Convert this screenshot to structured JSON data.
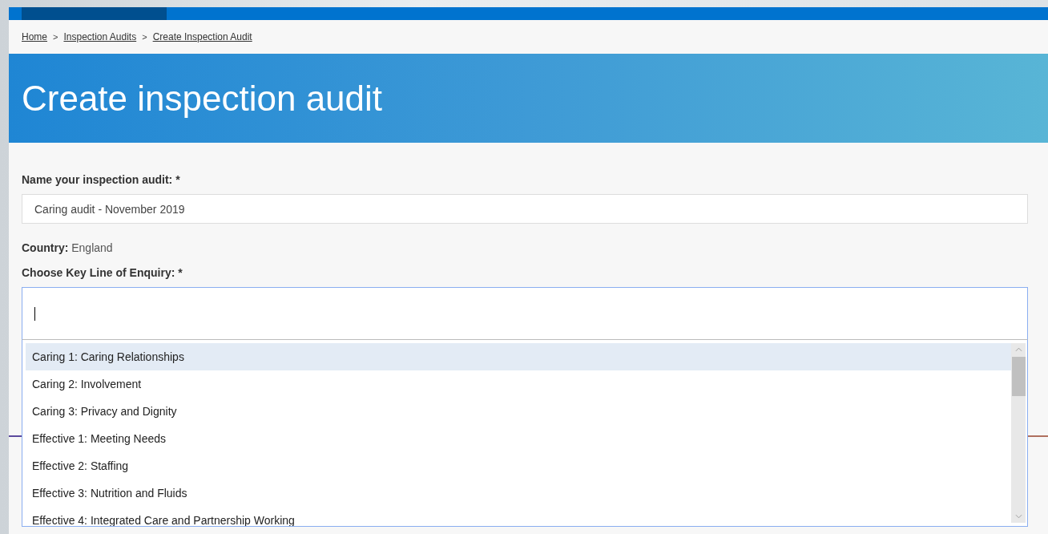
{
  "breadcrumb": [
    {
      "label": "Home"
    },
    {
      "label": "Inspection Audits"
    },
    {
      "label": "Create Inspection Audit"
    }
  ],
  "breadcrumb_separator": ">",
  "page_title": "Create inspection audit",
  "form": {
    "name_label": "Name your inspection audit: *",
    "name_value": "Caring audit - November 2019",
    "country_label": "Country:",
    "country_value": "England",
    "kloe_label": "Choose Key Line of Enquiry: *",
    "kloe_options": [
      {
        "label": "Caring 1: Caring Relationships",
        "selected": true
      },
      {
        "label": "Caring 2: Involvement",
        "selected": false
      },
      {
        "label": "Caring 3: Privacy and Dignity",
        "selected": false
      },
      {
        "label": "Effective 1: Meeting Needs",
        "selected": false
      },
      {
        "label": "Effective 2: Staffing",
        "selected": false
      },
      {
        "label": "Effective 3: Nutrition and Fluids",
        "selected": false
      },
      {
        "label": "Effective 4: Integrated Care and Partnership Working",
        "selected": false
      }
    ]
  }
}
